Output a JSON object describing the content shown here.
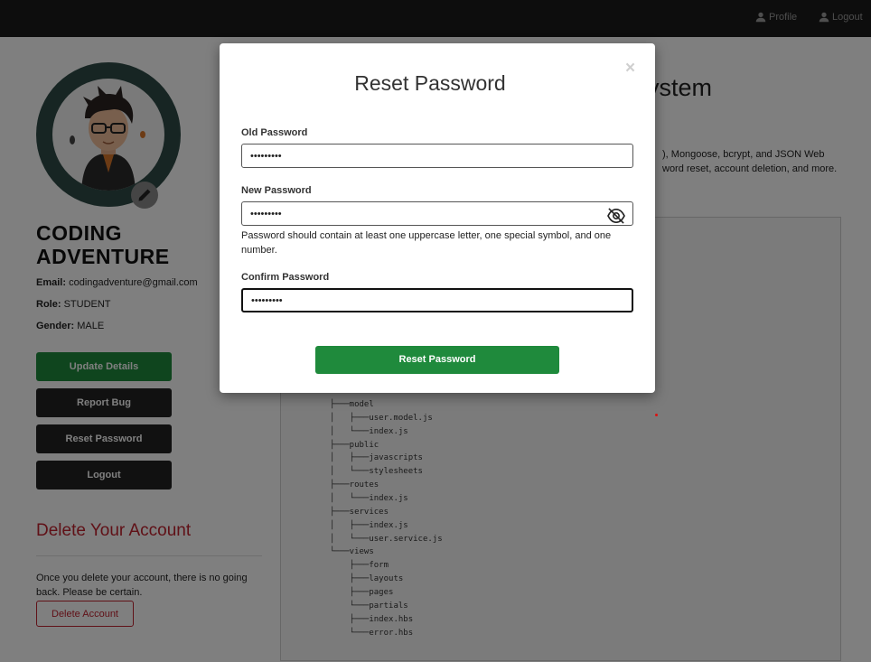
{
  "navbar": {
    "profile_label": "Profile",
    "logout_label": "Logout"
  },
  "profile": {
    "name": "CODING ADVENTURE",
    "email_label": "Email:",
    "email": "codingadventure@gmail.com",
    "role_label": "Role:",
    "role": "STUDENT",
    "gender_label": "Gender:",
    "gender": "MALE"
  },
  "sidebar": {
    "update_details": "Update Details",
    "report_bug": "Report Bug",
    "reset_password": "Reset Password",
    "logout": "Logout"
  },
  "delete_section": {
    "heading": "Delete Your Account",
    "text": "Once you delete your account, there is no going back. Please be certain.",
    "button": "Delete Account"
  },
  "main": {
    "title_partial": "ystem",
    "desc_line1": "), Mongoose, bcrypt, and JSON Web",
    "desc_line2": "word reset, account deletion, and more."
  },
  "tree": {
    "lines": [
      "├───model",
      "│   ├───user.model.js",
      "│   └───index.js",
      "├───public",
      "│   ├───javascripts",
      "│   └───stylesheets",
      "├───routes",
      "│   └───index.js",
      "├───services",
      "│   ├───index.js",
      "│   └───user.service.js",
      "└───views",
      "    ├───form",
      "    ├───layouts",
      "    ├───pages",
      "    └───partials",
      "    ├───index.hbs",
      "    └───error.hbs"
    ]
  },
  "modal": {
    "title": "Reset Password",
    "close": "×",
    "old_password_label": "Old Password",
    "old_password_value": "•••••••••",
    "new_password_label": "New Password",
    "new_password_value": "•••••••••",
    "hint": "Password should contain at least one uppercase letter, one special symbol, and one number.",
    "confirm_password_label": "Confirm Password",
    "confirm_password_value": "•••••••••",
    "submit": "Reset Password"
  },
  "colors": {
    "primary_green": "#1f8a3c",
    "dark_button": "#222222",
    "danger_red": "#c0222f",
    "navbar": "#1b1b1b"
  },
  "icons": {
    "nav_profile": "user-icon",
    "nav_logout": "user-icon",
    "avatar_edit": "pencil-icon",
    "password_toggle": "eye-slash-icon",
    "modal_close": "close-icon"
  }
}
